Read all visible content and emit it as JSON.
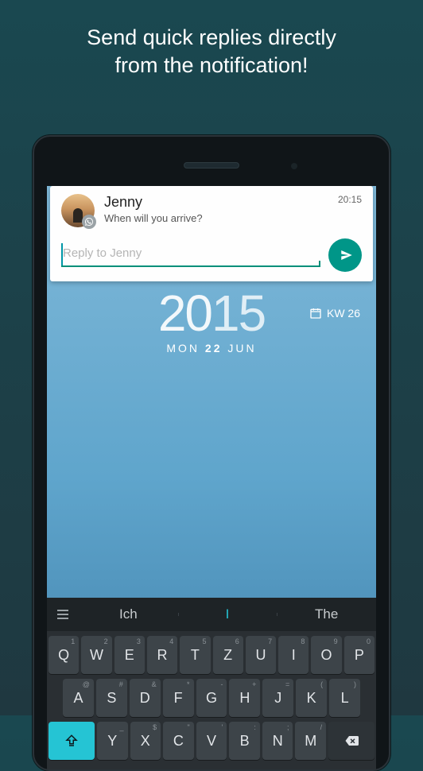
{
  "promo": {
    "line1": "Send quick replies directly",
    "line2": "from the notification!"
  },
  "notification": {
    "sender": "Jenny",
    "message": "When will you arrive?",
    "time": "20:15",
    "reply_placeholder": "Reply to Jenny",
    "avatar_badge_icon": "whatsapp-icon",
    "send_icon": "send-icon"
  },
  "clock": {
    "time_hours": "20",
    "time_minutes": "15",
    "date_day": "MON",
    "date_num": "22",
    "date_month": "JUN",
    "week_label": "KW 26"
  },
  "keyboard": {
    "suggestions": [
      "Ich",
      "I",
      "The"
    ],
    "row1": [
      {
        "k": "Q",
        "s": "1"
      },
      {
        "k": "W",
        "s": "2"
      },
      {
        "k": "E",
        "s": "3"
      },
      {
        "k": "R",
        "s": "4"
      },
      {
        "k": "T",
        "s": "5"
      },
      {
        "k": "Z",
        "s": "6"
      },
      {
        "k": "U",
        "s": "7"
      },
      {
        "k": "I",
        "s": "8"
      },
      {
        "k": "O",
        "s": "9"
      },
      {
        "k": "P",
        "s": "0"
      }
    ],
    "row2": [
      {
        "k": "A",
        "s": "@"
      },
      {
        "k": "S",
        "s": "#"
      },
      {
        "k": "D",
        "s": "&"
      },
      {
        "k": "F",
        "s": "*"
      },
      {
        "k": "G",
        "s": "-"
      },
      {
        "k": "H",
        "s": "+"
      },
      {
        "k": "J",
        "s": "="
      },
      {
        "k": "K",
        "s": "("
      },
      {
        "k": "L",
        "s": ")"
      }
    ],
    "row3": [
      {
        "k": "Y",
        "s": "_"
      },
      {
        "k": "X",
        "s": "$"
      },
      {
        "k": "C",
        "s": "\""
      },
      {
        "k": "V",
        "s": "'"
      },
      {
        "k": "B",
        "s": ":"
      },
      {
        "k": "N",
        "s": ";"
      },
      {
        "k": "M",
        "s": "/"
      }
    ]
  }
}
